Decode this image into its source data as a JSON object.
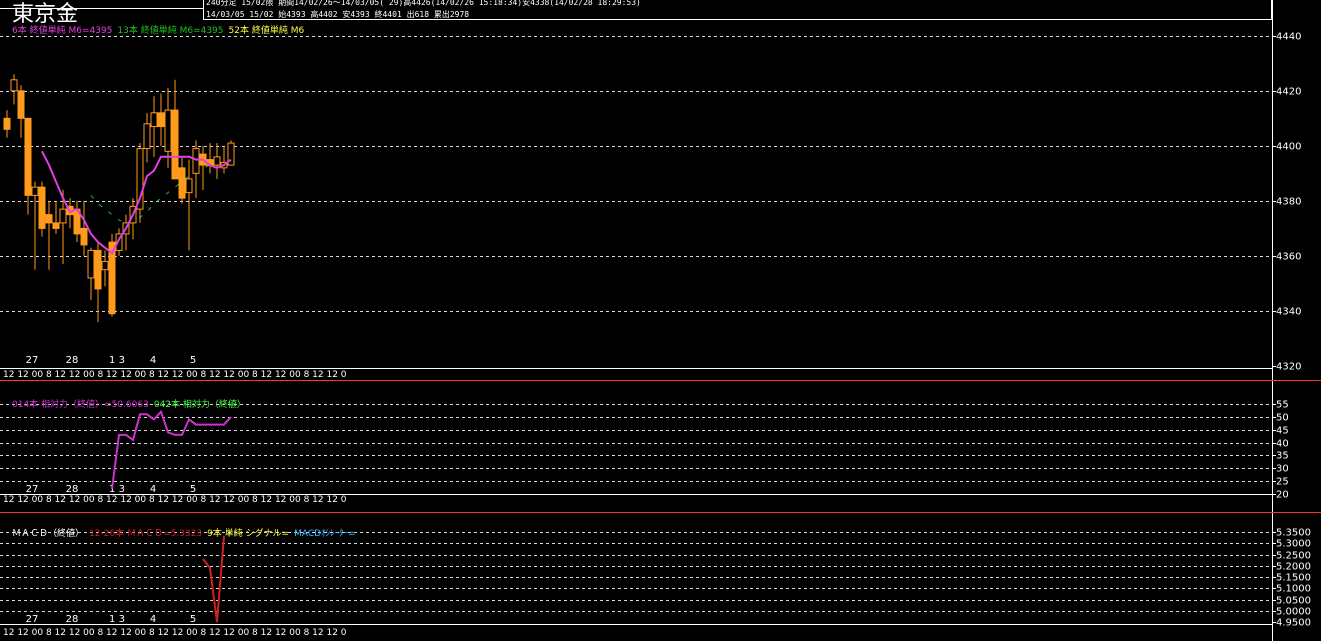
{
  "header": {
    "title": "東京金",
    "info_line_1": "240分足  15/02限  期間14/02/26～14/03/05(  29)高4426(14/02/26 15:18:34)安4338(14/02/28 18:29:53)",
    "info_line_2": "14/03/05 15/02 始4393 高4402 安4393 終4401 出618 累出2978"
  },
  "colors": {
    "background": "#000000",
    "candle": "#ff9a1a",
    "ma6": "#e040e0",
    "ma13": "#20c020",
    "ma52": "#ffff40",
    "rsi14": "#cc33cc",
    "rsi42": "#40ff40",
    "macd": "#cc2222",
    "signal": "#ffff40",
    "oscillator": "#40c0ff",
    "grid": "#ffffff",
    "divider": "#ff3030"
  },
  "chart_data": [
    {
      "type": "candlestick",
      "legend": [
        {
          "label": "6本 終値単純 M6=4395",
          "color": "#e040e0"
        },
        {
          "label": "13本 終値単純 M6=4395",
          "color": "#20c020"
        },
        {
          "label": "52本 終値単純 M6",
          "color": "#ffff40"
        }
      ],
      "ylim": [
        4320,
        4445
      ],
      "y_ticks": [
        4320,
        4340,
        4360,
        4380,
        4400,
        4420,
        4440
      ],
      "date_labels": [
        "27",
        "28",
        "1 3",
        "4",
        "5"
      ],
      "time_labels_text": "12 12 00 8 12 12 00 8 12 12 00 8 12 12 00 8 12 12 00 8 12 12 00 8 12 12 0",
      "candles": [
        {
          "o": 4410,
          "h": 4413,
          "l": 4403,
          "c": 4406
        },
        {
          "o": 4420,
          "h": 4426,
          "l": 4415,
          "c": 4424
        },
        {
          "o": 4420,
          "h": 4422,
          "l": 4403,
          "c": 4410
        },
        {
          "o": 4410,
          "h": 4410,
          "l": 4375,
          "c": 4382
        },
        {
          "o": 4382,
          "h": 4387,
          "l": 4355,
          "c": 4385
        },
        {
          "o": 4385,
          "h": 4387,
          "l": 4367,
          "c": 4370
        },
        {
          "o": 4375,
          "h": 4380,
          "l": 4355,
          "c": 4372
        },
        {
          "o": 4372,
          "h": 4380,
          "l": 4368,
          "c": 4370
        },
        {
          "o": 4372,
          "h": 4384,
          "l": 4357,
          "c": 4377
        },
        {
          "o": 4378,
          "h": 4381,
          "l": 4370,
          "c": 4375
        },
        {
          "o": 4377,
          "h": 4380,
          "l": 4365,
          "c": 4368
        },
        {
          "o": 4370,
          "h": 4380,
          "l": 4360,
          "c": 4364
        },
        {
          "o": 4352,
          "h": 4363,
          "l": 4344,
          "c": 4362
        },
        {
          "o": 4362,
          "h": 4365,
          "l": 4336,
          "c": 4348
        },
        {
          "o": 4355,
          "h": 4362,
          "l": 4349,
          "c": 4358
        },
        {
          "o": 4365,
          "h": 4368,
          "l": 4338,
          "c": 4339
        },
        {
          "o": 4362,
          "h": 4370,
          "l": 4360,
          "c": 4368
        },
        {
          "o": 4368,
          "h": 4375,
          "l": 4362,
          "c": 4372
        },
        {
          "o": 4372,
          "h": 4381,
          "l": 4366,
          "c": 4378
        },
        {
          "o": 4377,
          "h": 4401,
          "l": 4372,
          "c": 4399
        },
        {
          "o": 4399,
          "h": 4412,
          "l": 4394,
          "c": 4408
        },
        {
          "o": 4407,
          "h": 4418,
          "l": 4396,
          "c": 4412
        },
        {
          "o": 4412,
          "h": 4419,
          "l": 4400,
          "c": 4407
        },
        {
          "o": 4398,
          "h": 4421,
          "l": 4392,
          "c": 4413
        },
        {
          "o": 4413,
          "h": 4424,
          "l": 4388,
          "c": 4388
        },
        {
          "o": 4392,
          "h": 4396,
          "l": 4379,
          "c": 4381
        },
        {
          "o": 4383,
          "h": 4395,
          "l": 4362,
          "c": 4388
        },
        {
          "o": 4390,
          "h": 4402,
          "l": 4381,
          "c": 4399
        },
        {
          "o": 4397,
          "h": 4400,
          "l": 4384,
          "c": 4393
        },
        {
          "o": 4395,
          "h": 4401,
          "l": 4390,
          "c": 4393
        },
        {
          "o": 4393,
          "h": 4401,
          "l": 4388,
          "c": 4396
        },
        {
          "o": 4392,
          "h": 4400,
          "l": 4390,
          "c": 4394
        },
        {
          "o": 4393,
          "h": 4402,
          "l": 4393,
          "c": 4401
        }
      ],
      "ma6": [
        null,
        null,
        null,
        null,
        null,
        4398,
        4393,
        4387,
        4381,
        4376,
        4377,
        4373,
        4368,
        4365,
        4363,
        4361,
        4366,
        4370,
        4375,
        4381,
        4389,
        4391,
        4396,
        4396,
        4396,
        4396,
        4396,
        4395,
        4395,
        4393,
        4392,
        4393,
        4395
      ],
      "ma13": [
        null,
        null,
        null,
        null,
        null,
        null,
        null,
        null,
        null,
        null,
        null,
        null,
        4382,
        4379,
        4377,
        4375,
        4373,
        4372,
        4372,
        4374,
        4376,
        4379,
        4381,
        4383,
        4385,
        4387,
        4389,
        4391,
        4392,
        4393,
        4394,
        4394,
        4395
      ]
    },
    {
      "type": "line",
      "legend": [
        {
          "label": "014本 相対力（終値）=50.6063",
          "color": "#cc33cc"
        },
        {
          "label": "042本 相対力（終値）",
          "color": "#40ff40"
        }
      ],
      "ylim": [
        20,
        55
      ],
      "y_ticks": [
        20,
        25,
        30,
        35,
        40,
        45,
        50,
        55
      ],
      "date_labels": [
        "27",
        "28",
        "1 3",
        "4",
        "5"
      ],
      "time_labels_text": "12 12 00 8 12 12 00 8 12 12 00 8 12 12 00 8 12 12 00 8 12 12 00 8 12 12 0",
      "series": [
        {
          "name": "014本 相対力（終値）",
          "values": [
            null,
            null,
            null,
            null,
            null,
            null,
            null,
            null,
            null,
            null,
            null,
            null,
            null,
            null,
            null,
            22,
            43,
            43,
            41,
            51,
            51,
            49,
            52,
            44,
            43,
            43,
            49,
            47,
            47,
            47,
            47,
            47,
            50
          ]
        }
      ]
    },
    {
      "type": "line",
      "legend": [
        {
          "label": "ＭＡＣＤ（終値）",
          "color": "#ffffff"
        },
        {
          "label": "12-26本 ＭＡＣＤ=5.3323",
          "color": "#cc2222"
        },
        {
          "label": "9本 単純 シグナル=",
          "color": "#ffff40"
        },
        {
          "label": "MACDｵｼﾚｰﾀｰ=",
          "color": "#40c0ff"
        }
      ],
      "ylim": [
        4.95,
        5.35
      ],
      "y_ticks": [
        4.95,
        5.0,
        5.05,
        5.1,
        5.15,
        5.2,
        5.25,
        5.3,
        5.35
      ],
      "y_tick_labels": [
        "4.9500",
        "5.0000",
        "5.0500",
        "5.1000",
        "5.1500",
        "5.2000",
        "5.2500",
        "5.3000",
        "5.3500"
      ],
      "date_labels": [
        "27",
        "28",
        "1 3",
        "4",
        "5"
      ],
      "time_labels_text": "12 12 00 8 12 12 00 8 12 12 00 8 12 12 00 8 12 12 00 8 12 12 00 8 12 12 0",
      "series": [
        {
          "name": "12-26本 ＭＡＣＤ",
          "values": [
            null,
            null,
            null,
            null,
            null,
            null,
            null,
            null,
            null,
            null,
            null,
            null,
            null,
            null,
            null,
            null,
            null,
            null,
            null,
            null,
            null,
            null,
            null,
            null,
            null,
            null,
            null,
            null,
            5.23,
            5.19,
            4.95,
            5.3332,
            null
          ]
        }
      ]
    }
  ]
}
